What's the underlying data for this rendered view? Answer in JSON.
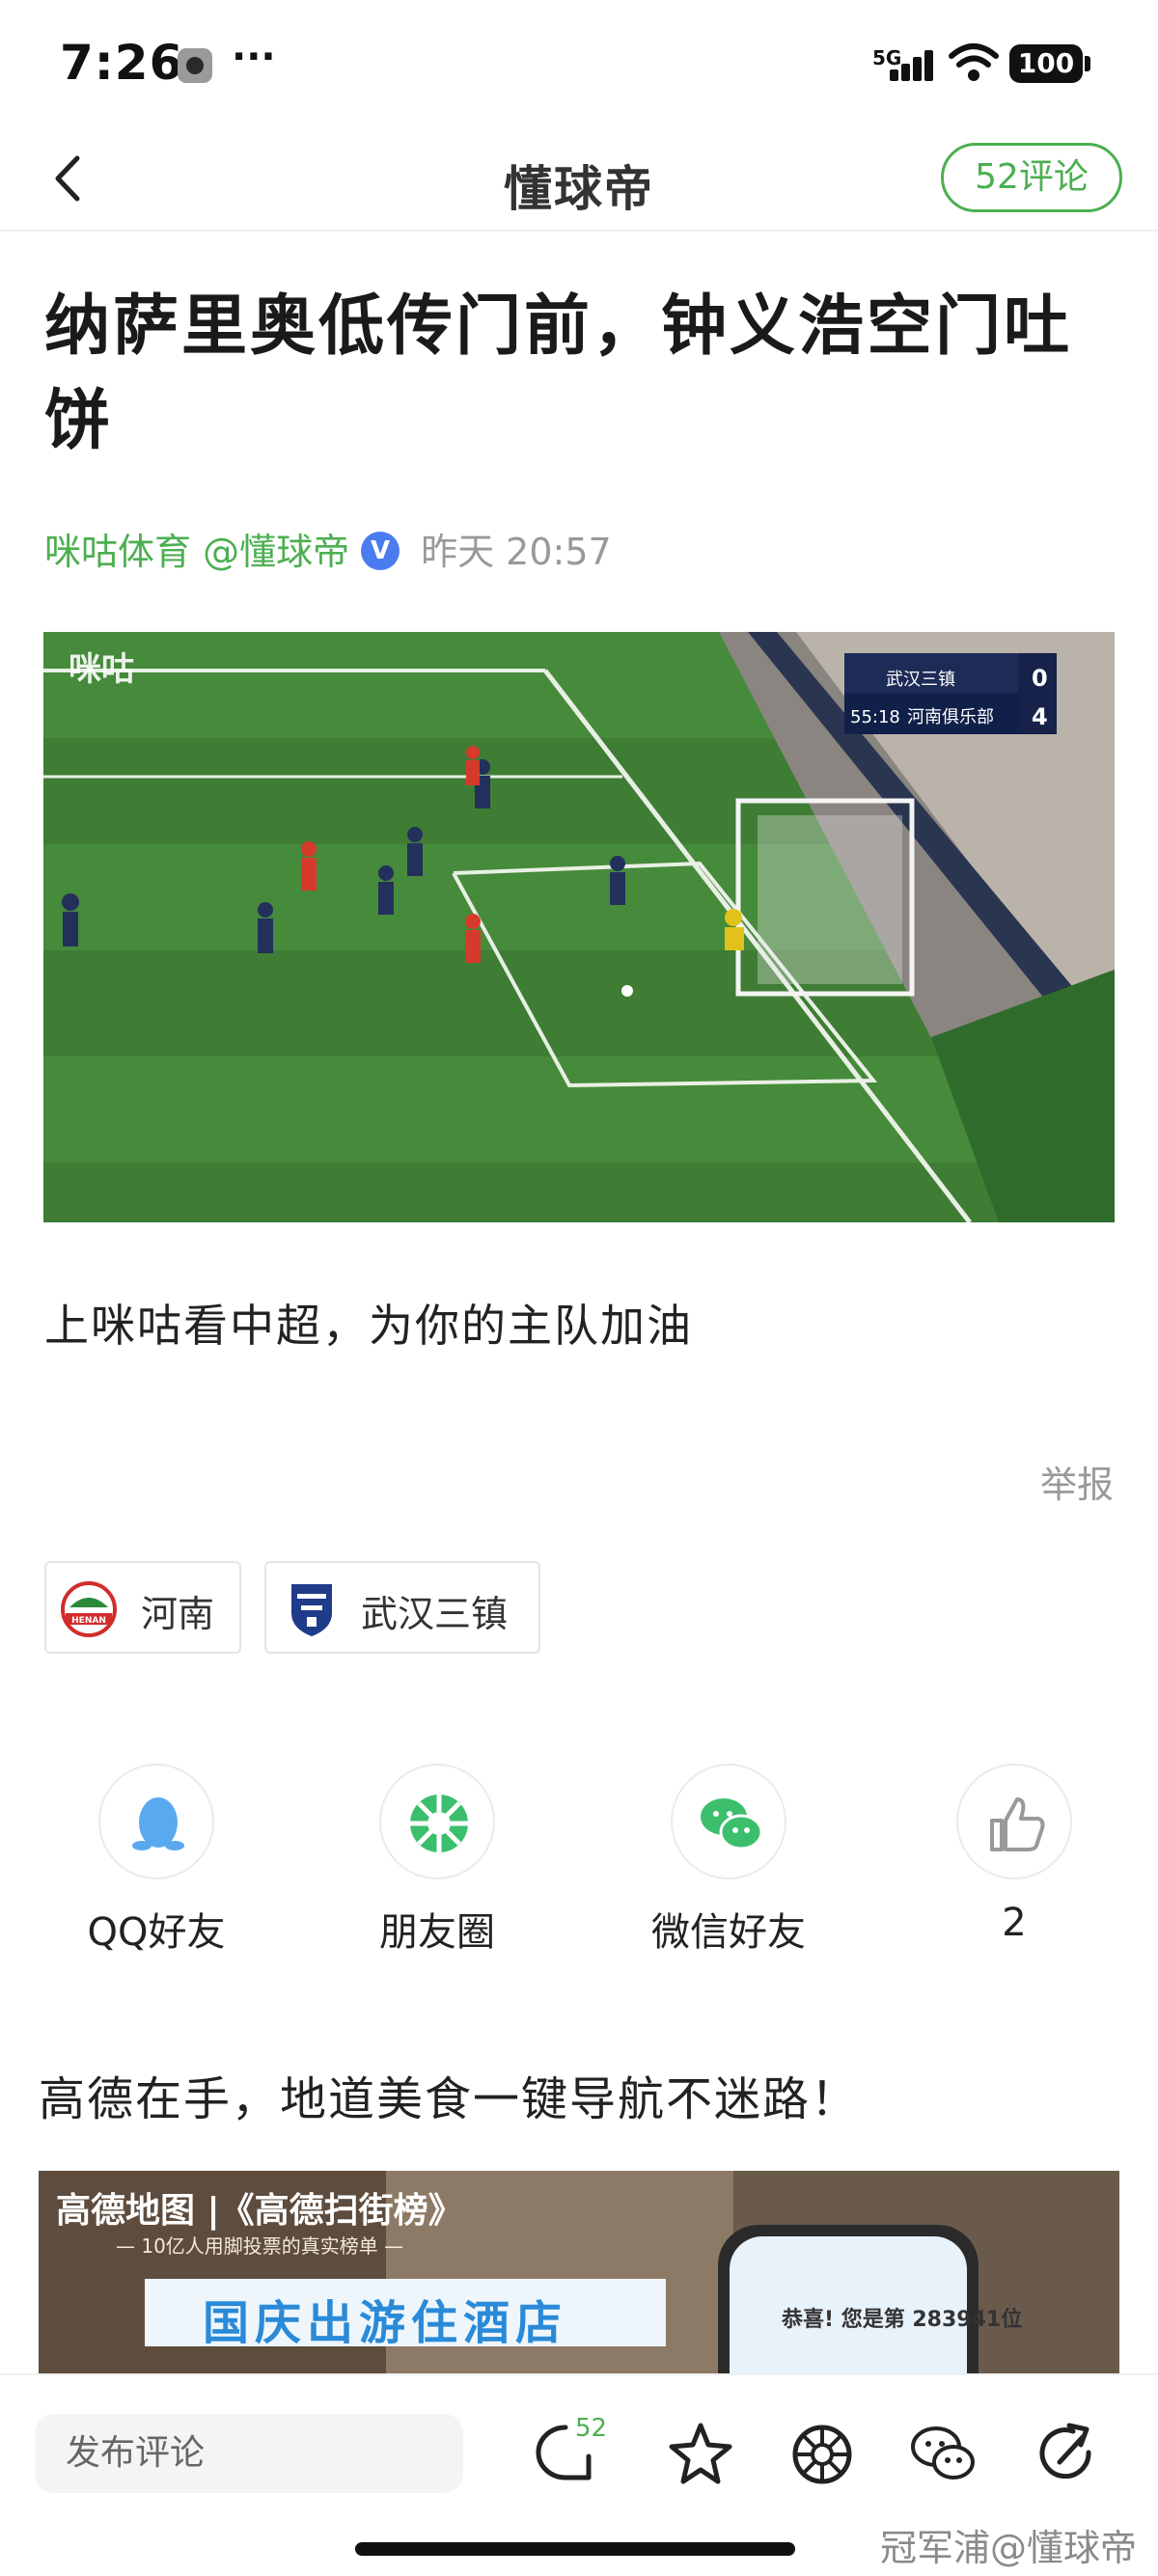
{
  "status_bar": {
    "time": "7:26",
    "dots": "···",
    "network": "5G",
    "battery": "100"
  },
  "nav": {
    "title": "懂球帝",
    "comments": "52评论"
  },
  "article": {
    "title": "纳萨里奥低传门前，钟义浩空门吐饼",
    "source": "咪咕体育 @懂球帝",
    "verified": "V",
    "time": "昨天 20:57",
    "summary": "上咪咕看中超，为你的主队加油",
    "report": "举报"
  },
  "video": {
    "logo": "咪咕",
    "clock": "55:18",
    "home_team": "武汉三镇",
    "home_score": "0",
    "away_team": "河南俱乐部",
    "away_score": "4"
  },
  "tags": [
    {
      "label": "河南",
      "badge": "HENAN"
    },
    {
      "label": "武汉三镇"
    }
  ],
  "share": [
    {
      "label": "QQ好友",
      "icon": "qq-icon"
    },
    {
      "label": "朋友圈",
      "icon": "moments-icon"
    },
    {
      "label": "微信好友",
      "icon": "wechat-icon"
    },
    {
      "label": "2",
      "icon": "thumbs-up-icon"
    }
  ],
  "ad": {
    "title": "高德在手，地道美食一键导航不迷路！",
    "brand": "高德地图 |《高德扫街榜》",
    "slogan": "— 10亿人用脚投票的真实榜单 —",
    "headline": "国庆出游住酒店",
    "phone_text": "恭喜! 您是第 283941位"
  },
  "bottom_bar": {
    "comment_placeholder": "发布评论",
    "comment_count": "52"
  },
  "watermark": "冠军浦@懂球帝",
  "colors": {
    "accent": "#4caf50",
    "verified": "#4a7cf0",
    "muted": "#999999"
  }
}
